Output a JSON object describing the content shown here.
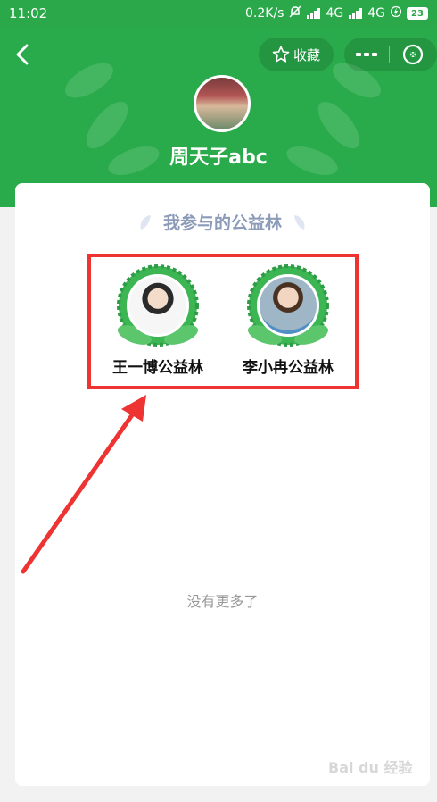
{
  "status_bar": {
    "time": "11:02",
    "network_speed": "0.2K/s",
    "signal1": "4G",
    "signal2": "4G",
    "battery": "23"
  },
  "header": {
    "favorite_label": "收藏",
    "username": "周天子abc",
    "accent_color": "#2aab4b"
  },
  "card": {
    "section_title": "我参与的公益林",
    "forests": [
      {
        "name": "王一博公益林"
      },
      {
        "name": "李小冉公益林"
      }
    ],
    "no_more": "没有更多了"
  },
  "annotation": {
    "highlight_color": "#ee3333"
  },
  "watermark": "Bai du 经验"
}
